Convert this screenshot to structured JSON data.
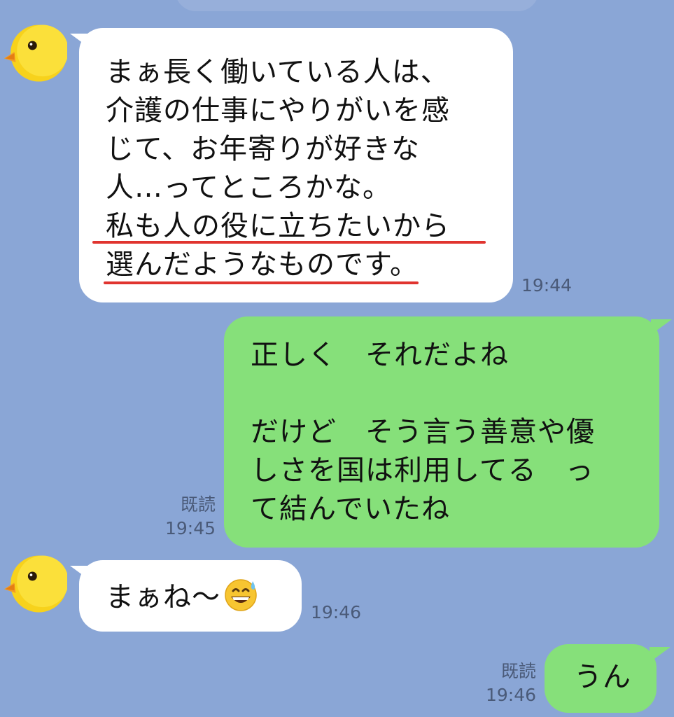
{
  "messages": [
    {
      "side": "in",
      "lines": [
        "まぁ長く働いている人は、",
        "介護の仕事にやりがいを感",
        "じて、お年寄りが好きな",
        "人…ってところかな。",
        "私も人の役に立ちたいから",
        "選んだようなものです。"
      ],
      "time": "19:44"
    },
    {
      "side": "out",
      "lines": [
        "正しく　それだよね",
        "",
        "だけど　そう言う善意や優",
        "しさを国は利用してる　っ",
        "て結んでいたね"
      ],
      "read": "既読",
      "time": "19:45"
    },
    {
      "side": "in",
      "text": "まぁね〜",
      "emoji": "grinning-face-with-sweat",
      "time": "19:46"
    },
    {
      "side": "out",
      "text": "うん",
      "read": "既読",
      "time": "19:46"
    }
  ],
  "colors": {
    "background": "#8aa6d6",
    "incoming_bubble": "#ffffff",
    "outgoing_bubble": "#86e07a",
    "highlight_underline": "#e0342f"
  },
  "icons": {
    "avatar": "chick-avatar-icon"
  }
}
